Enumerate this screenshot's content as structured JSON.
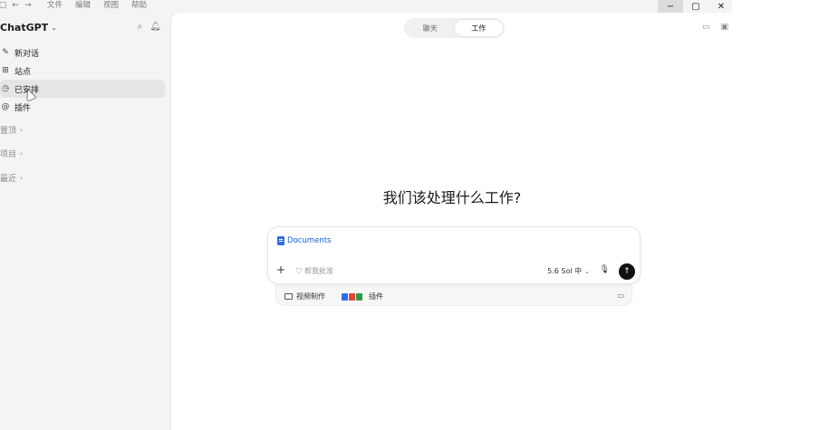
{
  "menubar": {
    "back_icon": "arrow-left-icon",
    "forward_icon": "arrow-right-icon",
    "items": [
      "文件",
      "编辑",
      "视图",
      "帮助"
    ]
  },
  "window_controls": {
    "minimize": "−",
    "maximize": "▢",
    "close": "✕"
  },
  "sidebar": {
    "brand": "ChatGPT",
    "nav": [
      {
        "label": "新对话",
        "icon": "edit-icon"
      },
      {
        "label": "站点",
        "icon": "sites-icon"
      },
      {
        "label": "已安排",
        "icon": "clock-icon",
        "active": true
      },
      {
        "label": "插件",
        "icon": "at-icon"
      }
    ],
    "sections": [
      "置顶",
      "项目",
      "最近"
    ]
  },
  "main": {
    "toggle": {
      "options": [
        "聊天",
        "工作"
      ],
      "active": "工作"
    },
    "headline": "我们该处理什么工作?",
    "composer": {
      "chip_label": "Documents",
      "approve_label": "帮我批准",
      "model_label": "5.6 Sol 中"
    },
    "tray": {
      "folder_label": "视频制作",
      "plugins_label": "插件"
    }
  },
  "colors": {
    "accent_blue": "#1a5fd6",
    "send_button": "#111111",
    "sidebar_bg": "#f4f4f4",
    "doc_blue": "#2f6fe4",
    "doc_red": "#e0443a",
    "doc_green": "#2c9a45"
  }
}
